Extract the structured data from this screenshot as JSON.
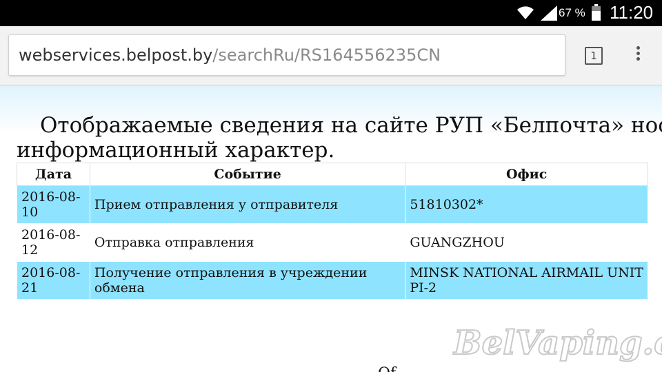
{
  "status_bar": {
    "battery_percent": "67 %",
    "time": "11:20"
  },
  "browser": {
    "url_domain": "webservices.belpost.by",
    "url_path": "/searchRu/RS164556235CN",
    "tab_count": "1"
  },
  "page": {
    "notice": "Отображаемые сведения на сайте РУП «Белпочта» носят информационный характер.",
    "table": {
      "headers": [
        "Дата",
        "Событие",
        "Офис"
      ],
      "rows": [
        {
          "date": "2016-08-10",
          "event": "Прием отправления у отправителя",
          "office": "51810302*"
        },
        {
          "date": "2016-08-12",
          "event": "Отправка отправления",
          "office": "GUANGZHOU"
        },
        {
          "date": "2016-08-21",
          "event": "Получение отправления в учреждении обмена",
          "office": "MINSK NATIONAL AIRMAIL UNIT PI-2"
        }
      ]
    },
    "watermark": "BelVaping.com",
    "footer_partial": "Of"
  },
  "colors": {
    "row_highlight": "#8ee3ff",
    "page_gradient_top": "#dff3fd",
    "status_bar_bg": "#000000"
  }
}
